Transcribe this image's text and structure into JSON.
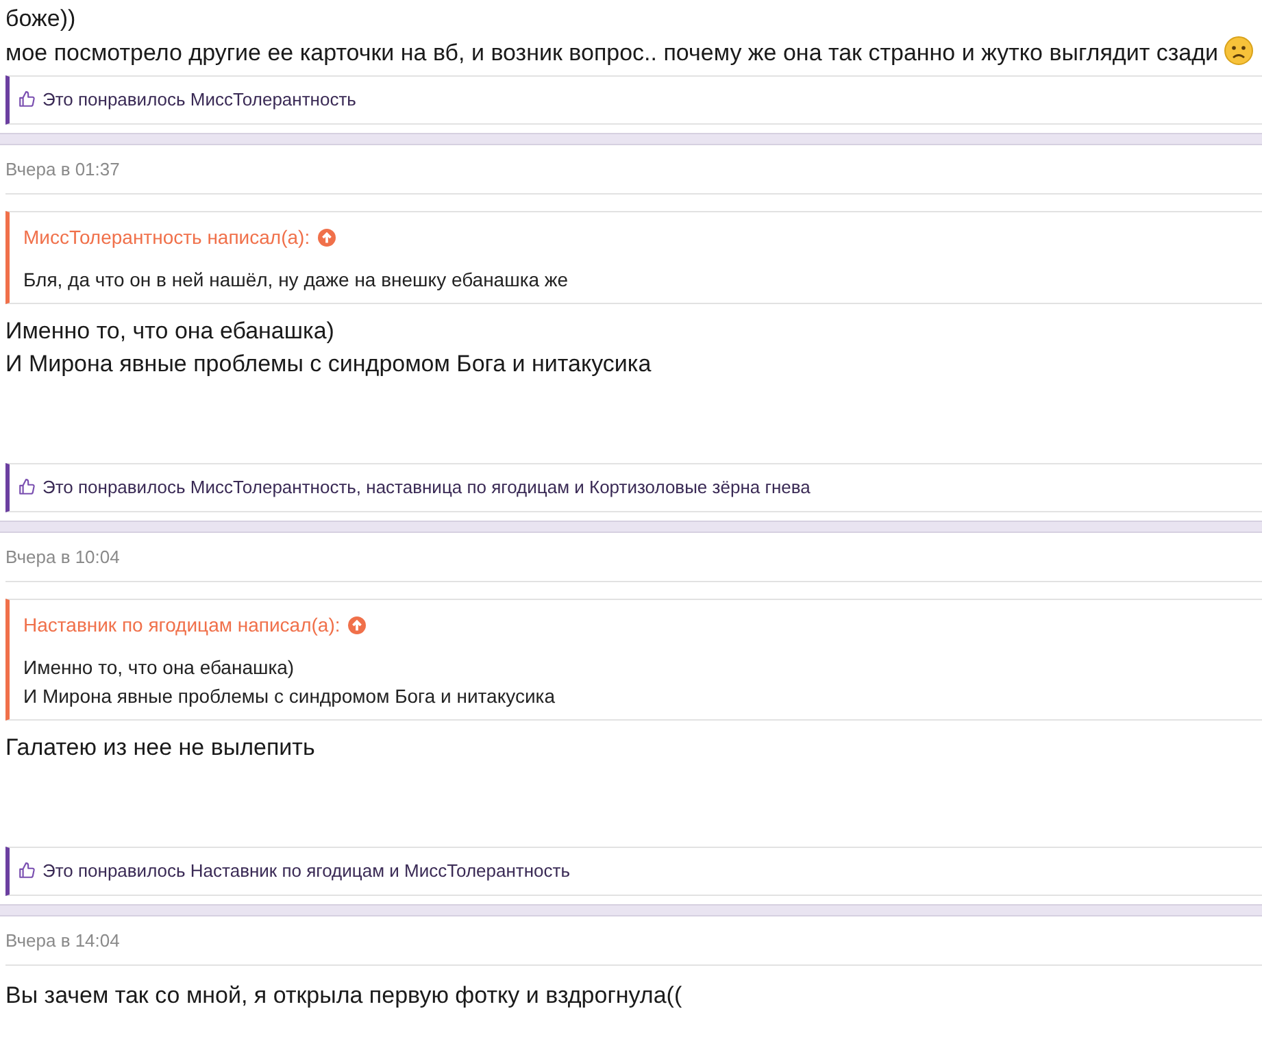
{
  "posts": [
    {
      "body": [
        {
          "text": "боже))",
          "emoji": false
        },
        {
          "text": "мое посмотрело другие ее карточки на вб, и возник вопрос.. почему же она так странно и жутко выглядит сзади",
          "emoji": true
        }
      ],
      "likes": "Это понравилось МиссТолерантность"
    },
    {
      "date": "Вчера в 01:37",
      "quote": {
        "author": "МиссТолерантность написал(а):",
        "lines": [
          "Бля, да что он в ней нашёл, ну даже на внешку ебанашка же"
        ]
      },
      "body": [
        {
          "text": "Именно то, что она ебанашка)",
          "emoji": false
        },
        {
          "text": "И Мирона явные проблемы с синдромом Бога и нитакусика",
          "emoji": false
        }
      ],
      "likes": "Это понравилось МиссТолерантность, наставница по ягодицам и Кортизоловые зёрна гнева"
    },
    {
      "date": "Вчера в 10:04",
      "quote": {
        "author": "Наставник по ягодицам написал(а):",
        "lines": [
          "Именно то, что она ебанашка)",
          "И Мирона явные проблемы с синдромом Бога и нитакусика"
        ]
      },
      "body": [
        {
          "text": "Галатею из нее не вылепить",
          "emoji": false
        }
      ],
      "likes": "Это понравилось Наставник по ягодицам и МиссТолерантность"
    },
    {
      "date": "Вчера в 14:04",
      "body": [
        {
          "text": "Вы зачем так со мной, я открыла первую фотку и вздрогнула((",
          "emoji": false
        }
      ]
    }
  ]
}
